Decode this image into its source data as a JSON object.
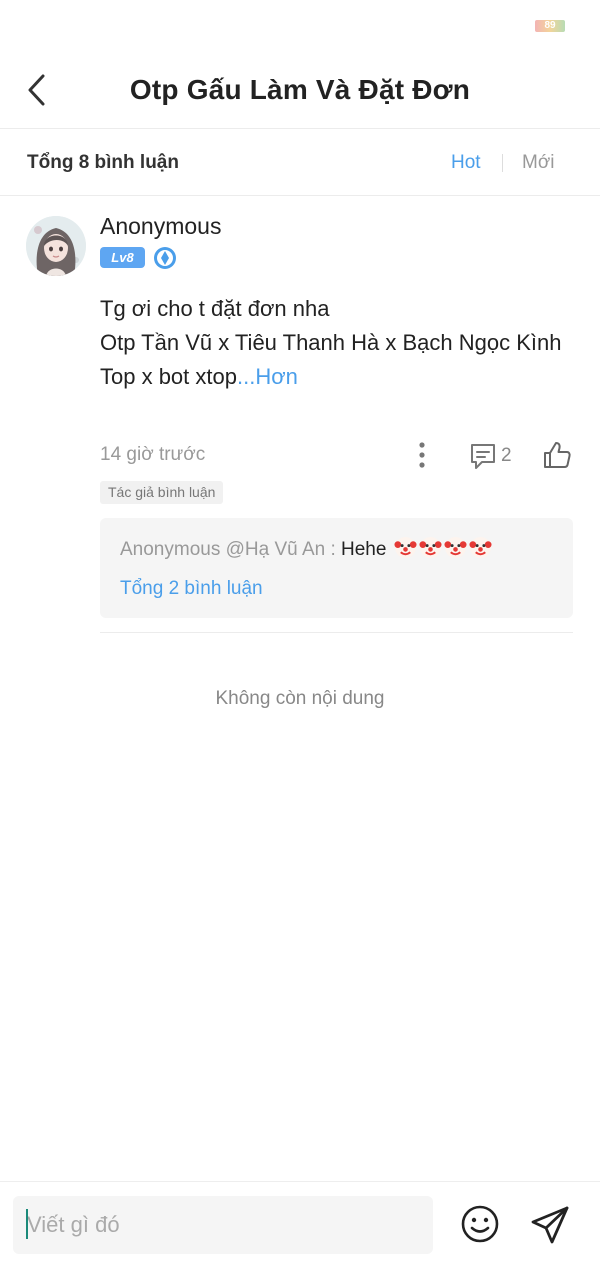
{
  "status_bar": {
    "battery_level": "89"
  },
  "header": {
    "title": "Otp Gấu Làm Và Đặt Đơn",
    "back_icon": "chevron-left-icon"
  },
  "sort_bar": {
    "total_label": "Tổng 8 bình luận",
    "hot_label": "Hot",
    "new_label": "Mới",
    "active": "Hot"
  },
  "comment": {
    "username": "Anonymous",
    "level": "Lv8",
    "content_lines": [
      "Tg ơi cho t đặt đơn nha",
      "Otp Tần Vũ x Tiêu Thanh Hà x Bạch Ngọc Kình",
      "Top x bot xtop"
    ],
    "more_label": "...Hơn",
    "time": "14 giờ trước",
    "reply_count": "2",
    "author_tag": "Tác giả bình luận",
    "replies_preview": {
      "prefix": "Anonymous @Hạ Vũ An : ",
      "text": "Hehe",
      "emoji": "clown-face-icon",
      "emoji_count": 4,
      "total_label": "Tổng 2 bình luận"
    }
  },
  "end_label": "Không còn nội dung",
  "bottom_bar": {
    "placeholder": "Viết gì đó",
    "emoji_icon": "smiley-icon",
    "send_icon": "send-icon"
  },
  "colors": {
    "accent": "#4a9eea",
    "level_badge": "#5ea6f2",
    "text": "#222222",
    "muted": "#999999"
  }
}
